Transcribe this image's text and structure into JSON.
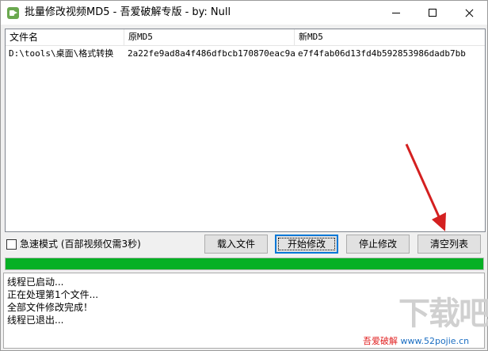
{
  "window": {
    "title": "批量修改视频MD5 - 吾爱破解专版 - by: Null"
  },
  "list": {
    "columns": [
      "文件名",
      "原MD5",
      "新MD5"
    ],
    "rows": [
      {
        "file": "D:\\tools\\桌面\\格式转换",
        "old_md5": "2a22fe9ad8a4f486dfbcb170870eac9a",
        "new_md5": "e7f4fab06d13fd4b592853986dadb7bb"
      }
    ]
  },
  "controls": {
    "fast_mode_label": "急速模式 (百部视频仅需3秒)",
    "fast_mode_checked": false,
    "load_button": "载入文件",
    "start_button": "开始修改",
    "stop_button": "停止修改",
    "clear_button": "清空列表"
  },
  "progress": {
    "value_percent": 100,
    "color": "#06b025"
  },
  "log": {
    "lines": [
      "线程已启动...",
      "正在处理第1个文件...",
      "全部文件修改完成！",
      "线程已退出..."
    ]
  },
  "watermark": {
    "big": "下载吧",
    "site_red": "吾爱破解",
    "site_url": "www.52pojie.cn"
  },
  "colors": {
    "annotation_arrow": "#d42020"
  }
}
